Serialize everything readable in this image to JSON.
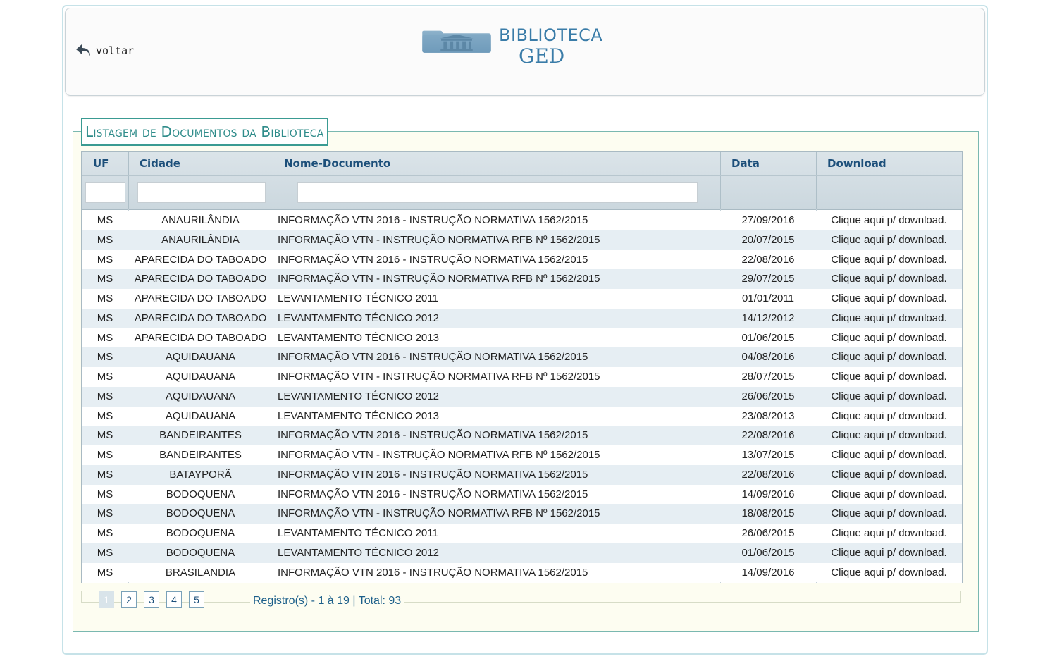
{
  "header": {
    "back_label": "voltar",
    "logo_line1": "BIBLIOTECA",
    "logo_line2": "GED"
  },
  "section": {
    "title": "Listagem de Documentos da Biblioteca"
  },
  "table": {
    "columns": [
      "UF",
      "Cidade",
      "Nome-Documento",
      "Data",
      "Download"
    ],
    "filters": {
      "uf": "",
      "cidade": "",
      "nome": ""
    },
    "rows": [
      {
        "uf": "MS",
        "cidade": "ANAURILÂNDIA",
        "nome": "INFORMAÇÃO VTN 2016 - INSTRUÇÃO NORMATIVA 1562/2015",
        "data": "27/09/2016",
        "download": "Clique aqui p/ download."
      },
      {
        "uf": "MS",
        "cidade": "ANAURILÂNDIA",
        "nome": "INFORMAÇÃO VTN - INSTRUÇÃO NORMATIVA RFB Nº 1562/2015",
        "data": "20/07/2015",
        "download": "Clique aqui p/ download."
      },
      {
        "uf": "MS",
        "cidade": "APARECIDA DO TABOADO",
        "nome": "INFORMAÇÃO VTN 2016 - INSTRUÇÃO NORMATIVA 1562/2015",
        "data": "22/08/2016",
        "download": "Clique aqui p/ download."
      },
      {
        "uf": "MS",
        "cidade": "APARECIDA DO TABOADO",
        "nome": "INFORMAÇÃO VTN - INSTRUÇÃO NORMATIVA RFB Nº 1562/2015",
        "data": "29/07/2015",
        "download": "Clique aqui p/ download."
      },
      {
        "uf": "MS",
        "cidade": "APARECIDA DO TABOADO",
        "nome": "LEVANTAMENTO TÉCNICO 2011",
        "data": "01/01/2011",
        "download": "Clique aqui p/ download."
      },
      {
        "uf": "MS",
        "cidade": "APARECIDA DO TABOADO",
        "nome": "LEVANTAMENTO TÉCNICO 2012",
        "data": "14/12/2012",
        "download": "Clique aqui p/ download."
      },
      {
        "uf": "MS",
        "cidade": "APARECIDA DO TABOADO",
        "nome": "LEVANTAMENTO TÉCNICO 2013",
        "data": "01/06/2015",
        "download": "Clique aqui p/ download."
      },
      {
        "uf": "MS",
        "cidade": "AQUIDAUANA",
        "nome": "INFORMAÇÃO VTN 2016 - INSTRUÇÃO NORMATIVA 1562/2015",
        "data": "04/08/2016",
        "download": "Clique aqui p/ download."
      },
      {
        "uf": "MS",
        "cidade": "AQUIDAUANA",
        "nome": "INFORMAÇÃO VTN - INSTRUÇÃO NORMATIVA RFB Nº 1562/2015",
        "data": "28/07/2015",
        "download": "Clique aqui p/ download."
      },
      {
        "uf": "MS",
        "cidade": "AQUIDAUANA",
        "nome": "LEVANTAMENTO TÉCNICO 2012",
        "data": "26/06/2015",
        "download": "Clique aqui p/ download."
      },
      {
        "uf": "MS",
        "cidade": "AQUIDAUANA",
        "nome": "LEVANTAMENTO TÉCNICO 2013",
        "data": "23/08/2013",
        "download": "Clique aqui p/ download."
      },
      {
        "uf": "MS",
        "cidade": "BANDEIRANTES",
        "nome": "INFORMAÇÃO VTN 2016 - INSTRUÇÃO NORMATIVA 1562/2015",
        "data": "22/08/2016",
        "download": "Clique aqui p/ download."
      },
      {
        "uf": "MS",
        "cidade": "BANDEIRANTES",
        "nome": "INFORMAÇÃO VTN - INSTRUÇÃO NORMATIVA RFB Nº 1562/2015",
        "data": "13/07/2015",
        "download": "Clique aqui p/ download."
      },
      {
        "uf": "MS",
        "cidade": "BATAYPORÃ",
        "nome": "INFORMAÇÃO VTN 2016 - INSTRUÇÃO NORMATIVA 1562/2015",
        "data": "22/08/2016",
        "download": "Clique aqui p/ download."
      },
      {
        "uf": "MS",
        "cidade": "BODOQUENA",
        "nome": "INFORMAÇÃO VTN 2016 - INSTRUÇÃO NORMATIVA 1562/2015",
        "data": "14/09/2016",
        "download": "Clique aqui p/ download."
      },
      {
        "uf": "MS",
        "cidade": "BODOQUENA",
        "nome": "INFORMAÇÃO VTN - INSTRUÇÃO NORMATIVA RFB Nº 1562/2015",
        "data": "18/08/2015",
        "download": "Clique aqui p/ download."
      },
      {
        "uf": "MS",
        "cidade": "BODOQUENA",
        "nome": "LEVANTAMENTO TÉCNICO 2011",
        "data": "26/06/2015",
        "download": "Clique aqui p/ download."
      },
      {
        "uf": "MS",
        "cidade": "BODOQUENA",
        "nome": "LEVANTAMENTO TÉCNICO 2012",
        "data": "01/06/2015",
        "download": "Clique aqui p/ download."
      },
      {
        "uf": "MS",
        "cidade": "BRASILANDIA",
        "nome": "INFORMAÇÃO VTN 2016 - INSTRUÇÃO NORMATIVA 1562/2015",
        "data": "14/09/2016",
        "download": "Clique aqui p/ download."
      }
    ]
  },
  "pager": {
    "pages": [
      "1",
      "2",
      "3",
      "4",
      "5"
    ],
    "current": "1",
    "records_text": "Registro(s) - 1 à 19 | Total: 93"
  },
  "colors": {
    "accent": "#2f8c8a",
    "header_text": "#1c4f7a",
    "row_alt": "#e6eef3",
    "logo": "#3a7ca8"
  },
  "icons": {
    "back": "back-arrow-icon",
    "logo": "folder-library-icon"
  }
}
